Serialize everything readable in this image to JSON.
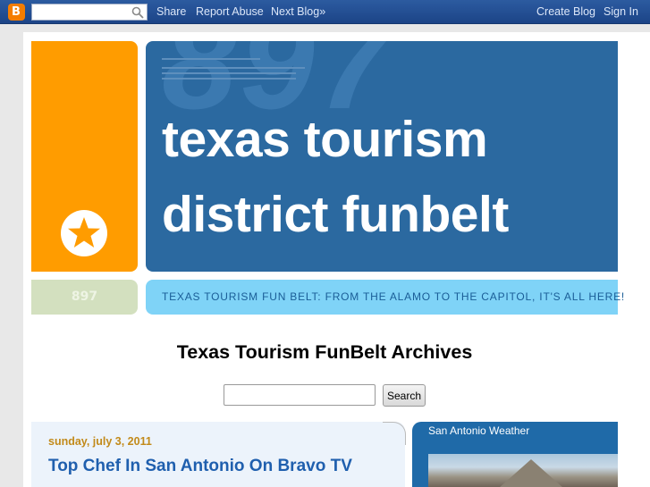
{
  "navbar": {
    "logo_letter": "B",
    "search_value": "",
    "links": {
      "share": "Share",
      "report_abuse": "Report Abuse",
      "next_blog": "Next Blog»",
      "create_blog": "Create Blog",
      "sign_in": "Sign In"
    }
  },
  "header": {
    "bg_number": "897",
    "title_line1": "texas tourism",
    "title_line2": "district funbelt",
    "number_label": "897",
    "tagline": "TEXAS TOURISM FUN BELT: FROM THE ALAMO TO THE CAPITOL, IT'S ALL HERE!"
  },
  "archive": {
    "title": "Texas Tourism FunBelt Archives",
    "search_value": "",
    "search_button": "Search"
  },
  "post": {
    "date": "sunday, july 3, 2011",
    "title": "Top Chef In San Antonio On Bravo TV"
  },
  "sidebar": {
    "widget_title": "San Antonio Weather"
  },
  "colors": {
    "navbar": "#2c5ba0",
    "orange": "#ff9c00",
    "header_blue": "#2b69a0",
    "tagline_bg": "#7fd3f7",
    "date_color": "#c28a1a",
    "post_title_color": "#1f5fae"
  }
}
